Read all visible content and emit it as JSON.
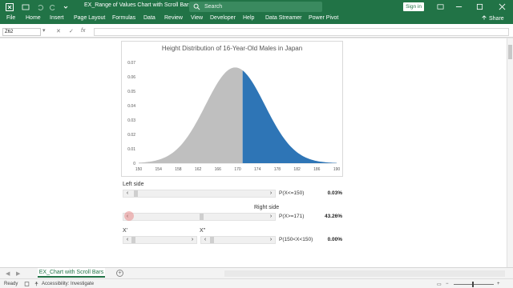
{
  "window": {
    "title": "EX_Range of Values Chart with Scroll Bars  -  Excel",
    "search_placeholder": "Search",
    "signin_label": "Sign in"
  },
  "ribbon": {
    "tabs": [
      "File",
      "Home",
      "Insert",
      "Page Layout",
      "Formulas",
      "Data",
      "Review",
      "View",
      "Developer",
      "Help",
      "Data Streamer",
      "Power Pivot"
    ],
    "share_label": "Share"
  },
  "formula_bar": {
    "name_box": "Z62",
    "formula": ""
  },
  "chart_data": {
    "type": "area",
    "title": "Height Distribution of 16-Year-Old Males in Japan",
    "x_ticks": [
      150,
      154,
      158,
      162,
      166,
      170,
      174,
      178,
      182,
      186,
      190
    ],
    "y_ticks": [
      0,
      0.01,
      0.02,
      0.03,
      0.04,
      0.05,
      0.06,
      0.07
    ],
    "xlim": [
      150,
      190
    ],
    "ylim": [
      0,
      0.07
    ],
    "distribution": {
      "mean": 169.5,
      "sd": 6.0
    },
    "series": [
      {
        "name": "",
        "range": [
          150,
          171
        ],
        "color": "#bfbfbf"
      },
      {
        "name": "",
        "range": [
          171,
          190
        ],
        "color": "#2e75b6"
      }
    ]
  },
  "controls": {
    "left_side_label": "Left side",
    "right_side_label": "Right side",
    "x_prime_label": "X'",
    "x_double_prime_label": "X\"",
    "rows": [
      {
        "prob_label": "P(X<=150)",
        "value": "0.03%",
        "thumb_position": 0.02
      },
      {
        "prob_label": "P(X>=171)",
        "value": "43.26%",
        "thumb_position": 0.52
      },
      {
        "prob_label": "P(150<X<150)",
        "value": "0.00%",
        "thumb_position": 0.0
      }
    ],
    "x_double_prime_thumb_position": 0.02
  },
  "sheet_tabs": {
    "active": "EX_Chart with Scroll Bars"
  },
  "status_bar": {
    "ready": "Ready",
    "accessibility": "Accessibility: Investigate"
  }
}
